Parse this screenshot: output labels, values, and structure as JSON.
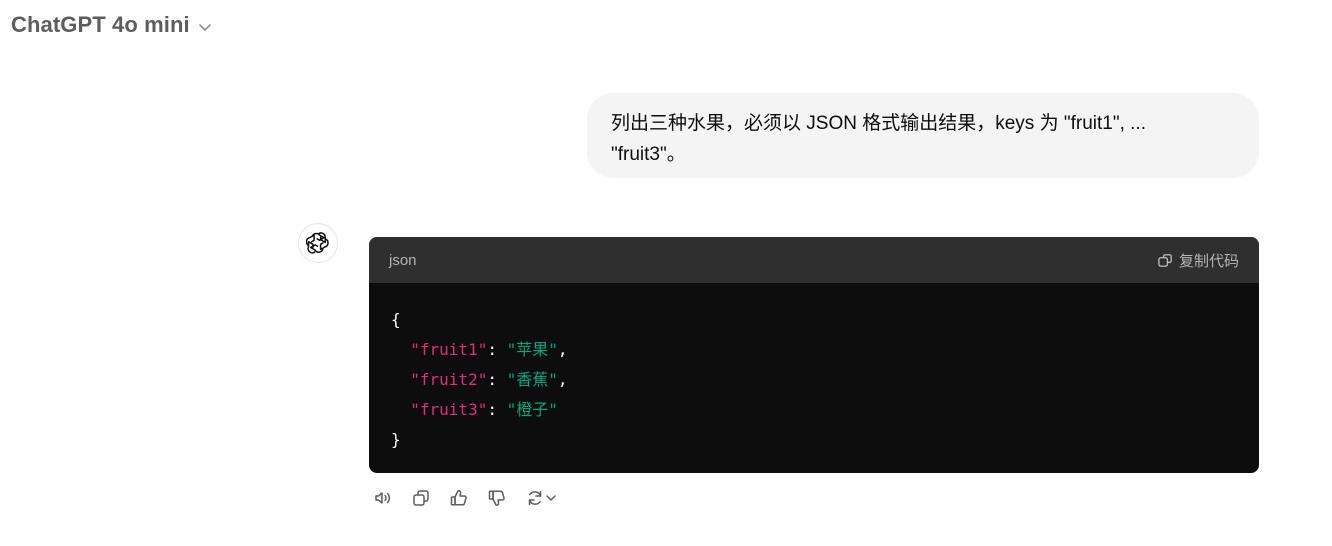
{
  "header": {
    "model_name": "ChatGPT 4o mini"
  },
  "conversation": {
    "user_message": "列出三种水果，必须以 JSON 格式输出结果，keys 为 \"fruit1\", ...\n\"fruit3\"。",
    "assistant": {
      "code_block": {
        "language": "json",
        "copy_label": "复制代码",
        "lines": {
          "open": "{",
          "l1": {
            "key": "\"fruit1\"",
            "sep": ": ",
            "value": "\"苹果\"",
            "trail": ","
          },
          "l2": {
            "key": "\"fruit2\"",
            "sep": ": ",
            "value": "\"香蕉\"",
            "trail": ","
          },
          "l3": {
            "key": "\"fruit3\"",
            "sep": ": ",
            "value": "\"橙子\"",
            "trail": ""
          },
          "close": "}"
        }
      }
    }
  },
  "actions": [
    "speaker-icon",
    "copy-icon",
    "thumbs-up-icon",
    "thumbs-down-icon",
    "regenerate-icon"
  ],
  "colors": {
    "key": "#df3079",
    "string": "#00a67d",
    "code_bg": "#0d0d0d",
    "code_header_bg": "#2f2f2f",
    "bubble_bg": "#f4f4f4"
  }
}
